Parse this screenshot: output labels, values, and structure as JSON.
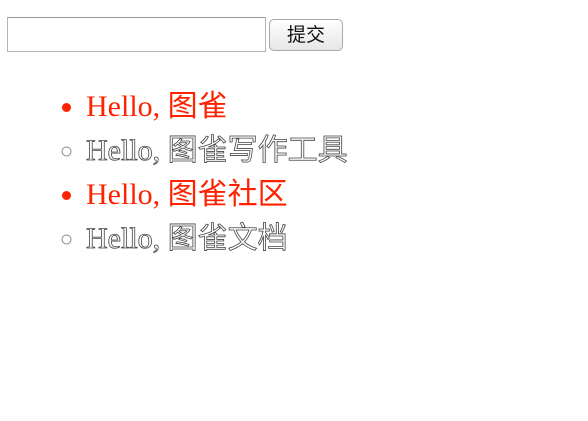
{
  "form": {
    "input_value": "",
    "input_placeholder": "",
    "submit_label": "提交"
  },
  "todos": [
    {
      "text": "Hello, 图雀",
      "status": "done",
      "color": "#ff2200"
    },
    {
      "text": "Hello, 图雀写作工具",
      "status": "open"
    },
    {
      "text": "Hello, 图雀社区",
      "status": "done",
      "color": "#ff2200"
    },
    {
      "text": "Hello, 图雀文档",
      "status": "open"
    }
  ]
}
